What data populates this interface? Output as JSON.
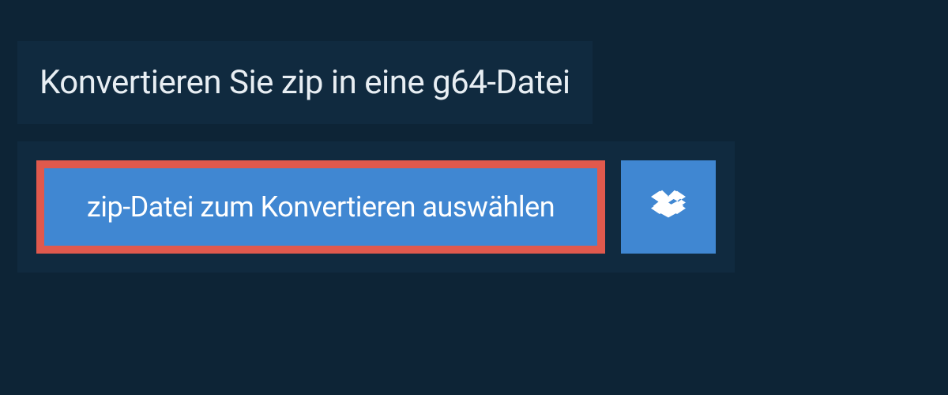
{
  "header": {
    "title": "Konvertieren Sie zip in eine g64-Datei"
  },
  "actions": {
    "select_file_label": "zip-Datei zum Konvertieren auswählen"
  },
  "colors": {
    "page_bg": "#0d2436",
    "panel_bg": "#102a3f",
    "button_bg": "#4087d2",
    "highlight_border": "#e0594d",
    "text_light": "#e8eef3",
    "text_white": "#ffffff"
  }
}
